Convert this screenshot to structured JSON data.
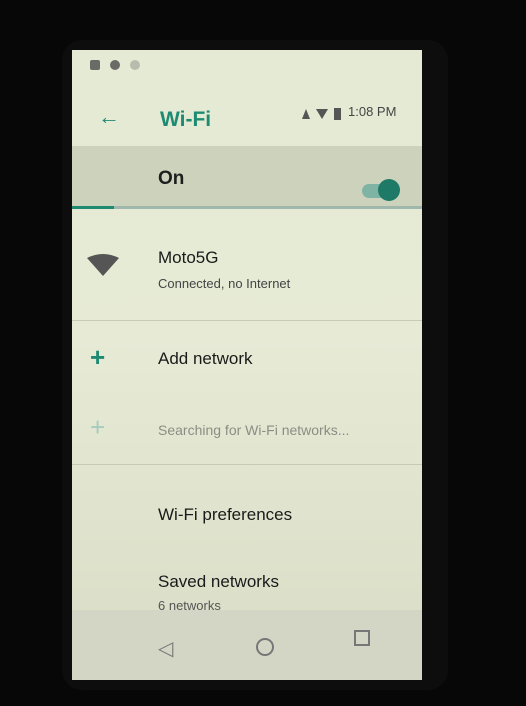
{
  "status_bar": {
    "time": "1:08 PM",
    "icons": [
      "notification-a-icon",
      "notification-b-icon",
      "notification-c-icon",
      "signal-icon",
      "wifi-signal-icon",
      "battery-icon"
    ]
  },
  "app_bar": {
    "title": "Wi-Fi",
    "back_icon": "arrow-left-icon",
    "back_glyph": "←"
  },
  "main_toggle": {
    "label": "On",
    "enabled": true
  },
  "networks": [
    {
      "name": "Moto5G",
      "status": "Connected, no Internet",
      "icon": "wifi-icon"
    }
  ],
  "add_network": {
    "label": "Add network",
    "icon": "plus-icon",
    "glyph": "+"
  },
  "searching": {
    "label": "Searching for Wi-Fi networks...",
    "icon": "plus-icon",
    "glyph": "+"
  },
  "preferences": {
    "label": "Wi-Fi preferences"
  },
  "saved_networks": {
    "label": "Saved networks",
    "subtitle": "6 networks"
  },
  "nav_bar": {
    "back_glyph": "◁",
    "items": [
      "back-icon",
      "home-icon",
      "recents-icon"
    ]
  },
  "colors": {
    "accent": "#1e8a72",
    "screen_bg": "#e4ead3"
  }
}
